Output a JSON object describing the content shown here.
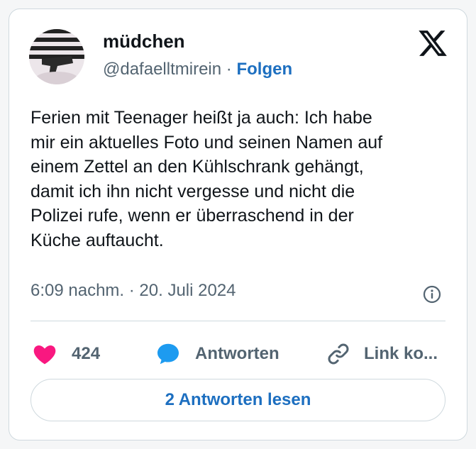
{
  "author": {
    "display_name": "müdchen",
    "handle": "@dafaelltmirein",
    "separator": "·",
    "follow_label": "Folgen"
  },
  "tweet": {
    "text": "Ferien mit Teenager heißt ja auch: Ich habe\nmir ein aktuelles Foto und seinen Namen auf\neinem Zettel an den Kühlschrank gehängt,\ndamit ich ihn nicht vergesse und nicht die\nPolizei rufe, wenn er überraschend in der\nKüche auftaucht.",
    "timestamp": "6:09 nachm. · 20. Juli 2024"
  },
  "actions": {
    "like_count": "424",
    "reply_label": "Antworten",
    "copy_link_label": "Link ko..."
  },
  "read_replies_label": "2 Antworten lesen",
  "icons": {
    "logo": "x-logo-icon",
    "info": "info-icon",
    "like": "heart-icon",
    "reply": "speech-bubble-icon",
    "link": "link-icon"
  },
  "colors": {
    "accent": "#1d6fc0",
    "like": "#f91880",
    "reply": "#1d9bf0",
    "secondary_text": "#536471",
    "border": "#cfd9de"
  }
}
